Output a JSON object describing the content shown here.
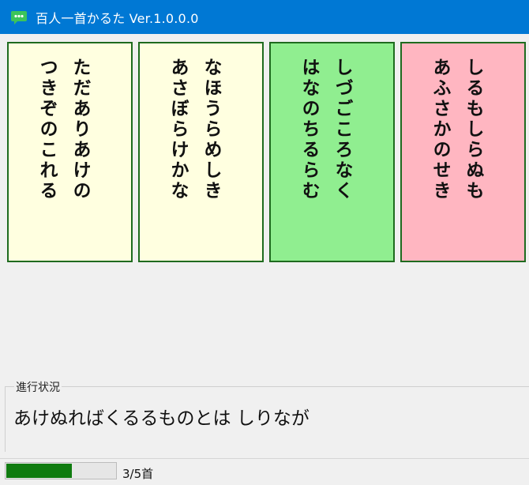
{
  "window": {
    "title": "百人一首かるた Ver.1.0.0.0",
    "icon": "chat-bubble-icon",
    "accent_color": "#0078d4"
  },
  "cards": [
    {
      "text": "ただありあけの\nつきぞのこれる",
      "background": "#ffffe0"
    },
    {
      "text": "なほうらめしき\nあさぼらけかな",
      "background": "#ffffe0"
    },
    {
      "text": "しづごころなく\nはなのちるらむ",
      "background": "#90ee90"
    },
    {
      "text": "しるもしらぬも\nあふさかのせき",
      "background": "#ffb6c1"
    }
  ],
  "progress": {
    "legend": "進行状況",
    "reading": "あけぬればくるるものとは しりなが"
  },
  "status": {
    "current": 3,
    "total": 5,
    "count_label": "3/5首",
    "bar_color": "#0f7b0f"
  }
}
